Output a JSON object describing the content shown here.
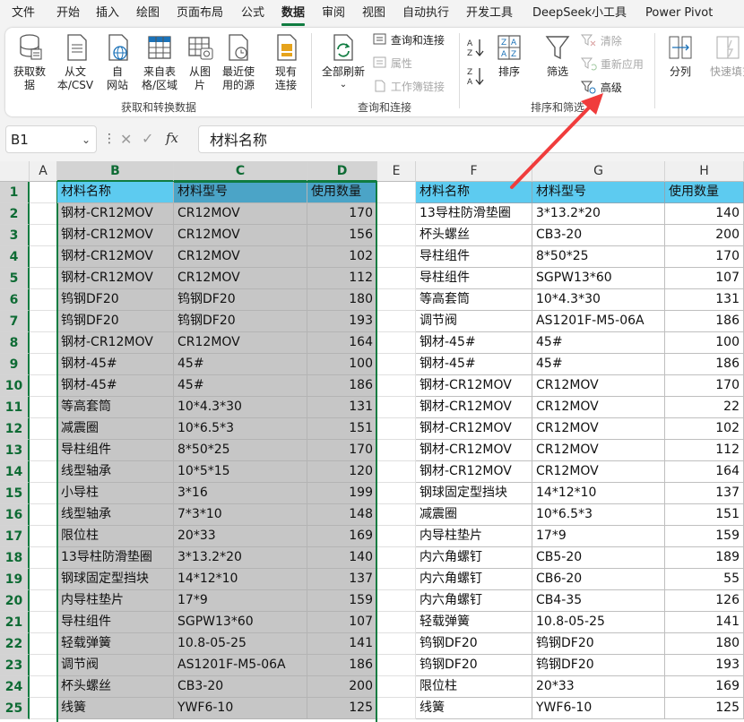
{
  "menu": [
    "文件",
    "开始",
    "插入",
    "绘图",
    "页面布局",
    "公式",
    "数据",
    "审阅",
    "视图",
    "自动执行",
    "开发工具",
    "DeepSeek小工具",
    "Power Pivot"
  ],
  "active_tab": "数据",
  "ribbon": {
    "get_data": "获取数\n据",
    "from_text_csv": "从文\n本/CSV",
    "from_web": "自\n网站",
    "from_table": "来自表\n格/区域",
    "from_picture": "从图\n片",
    "recent_sources": "最近使\n用的源",
    "existing_connections": "现有\n连接",
    "group_get_transform": "获取和转换数据",
    "refresh_all": "全部刷新",
    "queries_connections": "查询和连接",
    "properties": "属性",
    "workbook_links": "工作簿链接",
    "group_queries": "查询和连接",
    "sort_az": "A↓Z",
    "sort_za": "Z↓A",
    "sort": "排序",
    "filter": "筛选",
    "clear": "清除",
    "reapply": "重新应用",
    "advanced": "高级",
    "group_sort_filter": "排序和筛选",
    "text_to_columns": "分列",
    "flash_fill": "快速填充"
  },
  "formula_bar": {
    "name_box": "B1",
    "fx": "fx",
    "value": "材料名称"
  },
  "colors": {
    "header_fill": "#5dcbf0",
    "accent": "#107c41",
    "arrow": "#f03c3c"
  },
  "columns": [
    "A",
    "B",
    "C",
    "D",
    "E",
    "F",
    "G",
    "H"
  ],
  "rows": [
    "1",
    "2",
    "3",
    "4",
    "5",
    "6",
    "7",
    "8",
    "9",
    "10",
    "11",
    "12",
    "13",
    "14",
    "15",
    "16",
    "17",
    "18",
    "19",
    "20",
    "21",
    "22",
    "23",
    "24",
    "25"
  ],
  "table_left": {
    "headers": [
      "材料名称",
      "材料型号",
      "使用数量"
    ],
    "rows": [
      [
        "钢材-CR12MOV",
        "CR12MOV",
        "170"
      ],
      [
        "钢材-CR12MOV",
        "CR12MOV",
        "156"
      ],
      [
        "钢材-CR12MOV",
        "CR12MOV",
        "102"
      ],
      [
        "钢材-CR12MOV",
        "CR12MOV",
        "112"
      ],
      [
        "钨钢DF20",
        "钨钢DF20",
        "180"
      ],
      [
        "钨钢DF20",
        "钨钢DF20",
        "193"
      ],
      [
        "钢材-CR12MOV",
        "CR12MOV",
        "164"
      ],
      [
        "钢材-45#",
        "45#",
        "100"
      ],
      [
        "钢材-45#",
        "45#",
        "186"
      ],
      [
        "等高套筒",
        "10*4.3*30",
        "131"
      ],
      [
        "减震圈",
        "10*6.5*3",
        "151"
      ],
      [
        "导柱组件",
        "8*50*25",
        "170"
      ],
      [
        "线型轴承",
        "10*5*15",
        "120"
      ],
      [
        "小导柱",
        "3*16",
        "199"
      ],
      [
        "线型轴承",
        "7*3*10",
        "148"
      ],
      [
        "限位柱",
        "20*33",
        "169"
      ],
      [
        "13导柱防滑垫圈",
        "3*13.2*20",
        "140"
      ],
      [
        "钢球固定型挡块",
        "14*12*10",
        "137"
      ],
      [
        "内导柱垫片",
        "17*9",
        "159"
      ],
      [
        "导柱组件",
        "SGPW13*60",
        "107"
      ],
      [
        "轻载弹簧",
        "10.8-05-25",
        "141"
      ],
      [
        "调节阀",
        "AS1201F-M5-06A",
        "186"
      ],
      [
        "杯头螺丝",
        "CB3-20",
        "200"
      ],
      [
        "线簧",
        "YWF6-10",
        "125"
      ]
    ]
  },
  "table_right": {
    "headers": [
      "材料名称",
      "材料型号",
      "使用数量"
    ],
    "rows": [
      [
        "13导柱防滑垫圈",
        "3*13.2*20",
        "140"
      ],
      [
        "杯头螺丝",
        "CB3-20",
        "200"
      ],
      [
        "导柱组件",
        "8*50*25",
        "170"
      ],
      [
        "导柱组件",
        "SGPW13*60",
        "107"
      ],
      [
        "等高套筒",
        "10*4.3*30",
        "131"
      ],
      [
        "调节阀",
        "AS1201F-M5-06A",
        "186"
      ],
      [
        "钢材-45#",
        "45#",
        "100"
      ],
      [
        "钢材-45#",
        "45#",
        "186"
      ],
      [
        "钢材-CR12MOV",
        "CR12MOV",
        "170"
      ],
      [
        "钢材-CR12MOV",
        "CR12MOV",
        "22"
      ],
      [
        "钢材-CR12MOV",
        "CR12MOV",
        "102"
      ],
      [
        "钢材-CR12MOV",
        "CR12MOV",
        "112"
      ],
      [
        "钢材-CR12MOV",
        "CR12MOV",
        "164"
      ],
      [
        "钢球固定型挡块",
        "14*12*10",
        "137"
      ],
      [
        "减震圈",
        "10*6.5*3",
        "151"
      ],
      [
        "内导柱垫片",
        "17*9",
        "159"
      ],
      [
        "内六角螺钉",
        "CB5-20",
        "189"
      ],
      [
        "内六角螺钉",
        "CB6-20",
        "55"
      ],
      [
        "内六角螺钉",
        "CB4-35",
        "126"
      ],
      [
        "轻载弹簧",
        "10.8-05-25",
        "141"
      ],
      [
        "钨钢DF20",
        "钨钢DF20",
        "180"
      ],
      [
        "钨钢DF20",
        "钨钢DF20",
        "193"
      ],
      [
        "限位柱",
        "20*33",
        "169"
      ],
      [
        "线簧",
        "YWF6-10",
        "125"
      ]
    ]
  }
}
